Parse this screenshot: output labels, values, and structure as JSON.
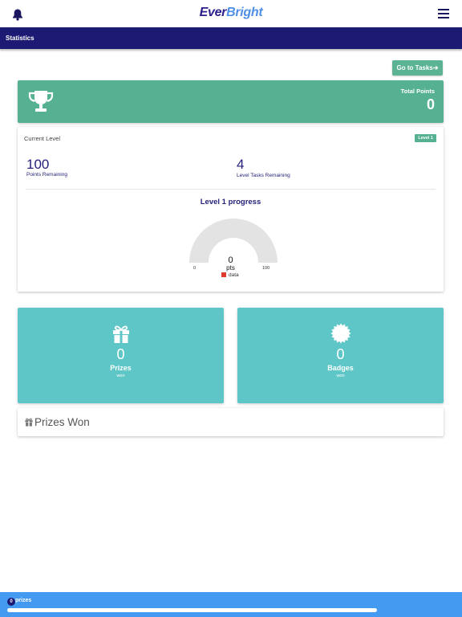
{
  "header": {
    "logo_part1": "Ever",
    "logo_part2": "Bright",
    "bell_icon": "bell-icon",
    "menu_icon": "hamburger-menu-icon"
  },
  "nav": {
    "title": "Statistics"
  },
  "go_tasks": {
    "label": "Go to Tasks",
    "icon": "arrow-right-icon"
  },
  "points": {
    "icon": "trophy-icon",
    "label": "Total Points",
    "value": "0"
  },
  "level": {
    "label": "Current Level",
    "badge": "Level 1",
    "points_remaining": "100",
    "points_remaining_label": "Points Remaining",
    "tasks_remaining": "4",
    "tasks_remaining_label": "Level Tasks Remaining",
    "progress_title": "Level 1 progress"
  },
  "chart_data": {
    "type": "gauge",
    "title": "Level 1 progress",
    "value": 0,
    "unit": "pts",
    "min": 0,
    "max": 100,
    "min_label": "0",
    "max_label": "100",
    "value_label": "0",
    "series": [
      {
        "name": "data",
        "values": [
          0
        ]
      }
    ],
    "track_color": "#e3e3e3",
    "fill_color": "#e03a2c",
    "legend_color": "#e03a2c"
  },
  "tiles": {
    "prizes": {
      "icon": "gift-icon",
      "count": "0",
      "label": "Prizes",
      "sub": "won"
    },
    "badges": {
      "icon": "badge-icon",
      "count": "0",
      "label": "Badges",
      "sub": "won"
    }
  },
  "prizes_won": {
    "icon": "gift-icon",
    "title": "Prizes Won"
  },
  "footer": {
    "count": "0",
    "label": "prizes",
    "progress": 0.0
  },
  "colors": {
    "brand_dark": "#1c1a73",
    "green": "#56b192",
    "teal": "#5ec6c6",
    "footer_blue": "#4499f0"
  }
}
